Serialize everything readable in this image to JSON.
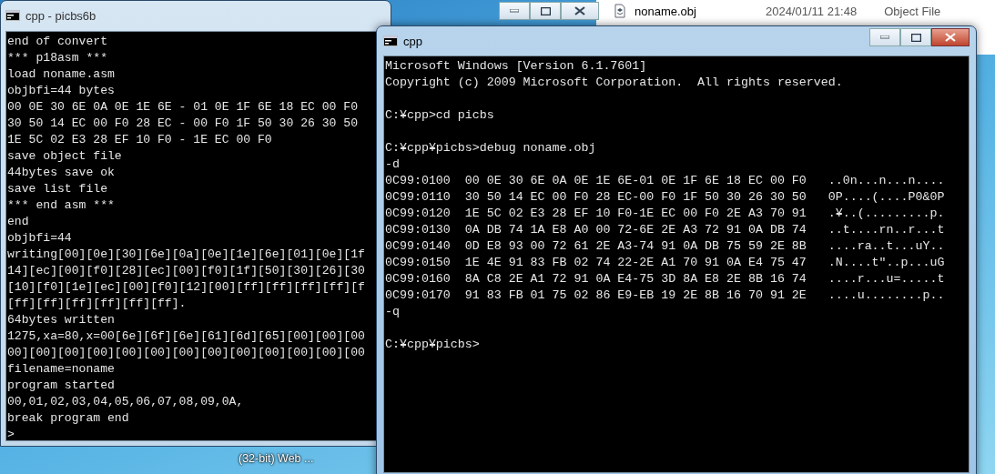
{
  "explorer": {
    "file": {
      "name": "noname.obj",
      "modified": "2024/01/11 21:48",
      "type": "Object File"
    }
  },
  "desktop_icons": [
    {
      "label": "(32-bit) Web ..."
    }
  ],
  "windows": [
    {
      "title": "cpp - picbs6b",
      "active": false,
      "blocks": [
        [
          "end of convert",
          "*** p18asm ***",
          "load noname.asm",
          "objbfi=44 bytes",
          "00 0E 30 6E 0A 0E 1E 6E - 01 0E 1F 6E 18 EC 00 F0",
          "30 50 14 EC 00 F0 28 EC - 00 F0 1F 50 30 26 30 50",
          "1E 5C 02 E3 28 EF 10 F0 - 1E EC 00 F0",
          "save object file",
          "44bytes save ok",
          "save list file",
          "*** end asm ***",
          "end",
          "objbfi=44",
          "writing[00][0e][30][6e][0a][0e][1e][6e][01][0e][1f",
          "14][ec][00][f0][28][ec][00][f0][1f][50][30][26][30",
          "[10][f0][1e][ec][00][f0][12][00][ff][ff][ff][ff][f",
          "[ff][ff][ff][ff][ff][ff].",
          "64bytes written",
          "1275,xa=80,x=00[6e][6f][6e][61][6d][65][00][00][00",
          "00][00][00][00][00][00][00][00][00][00][00][00][00",
          "filename=noname",
          "program started",
          "00,01,02,03,04,05,06,07,08,09,0A,",
          "break program end",
          ">"
        ]
      ]
    },
    {
      "title": "cpp",
      "active": true,
      "blocks": [
        [
          "Microsoft Windows [Version 6.1.7601]",
          "Copyright (c) 2009 Microsoft Corporation.  All rights reserved."
        ],
        [
          "C:¥cpp>cd picbs"
        ],
        [
          "C:¥cpp¥picbs>debug noname.obj",
          "-d",
          "0C99:0100  00 0E 30 6E 0A 0E 1E 6E-01 0E 1F 6E 18 EC 00 F0   ..0n...n...n....",
          "0C99:0110  30 50 14 EC 00 F0 28 EC-00 F0 1F 50 30 26 30 50   0P....(....P0&0P",
          "0C99:0120  1E 5C 02 E3 28 EF 10 F0-1E EC 00 F0 2E A3 70 91   .¥..(.........p.",
          "0C99:0130  0A DB 74 1A E8 A0 00 72-6E 2E A3 72 91 0A DB 74   ..t....rn..r...t",
          "0C99:0140  0D E8 93 00 72 61 2E A3-74 91 0A DB 75 59 2E 8B   ....ra..t...uY..",
          "0C99:0150  1E 4E 91 83 FB 02 74 22-2E A1 70 91 0A E4 75 47   .N....t\"..p...uG",
          "0C99:0160  8A C8 2E A1 72 91 0A E4-75 3D 8A E8 2E 8B 16 74   ....r...u=.....t",
          "0C99:0170  91 83 FB 01 75 02 86 E9-EB 19 2E 8B 16 70 91 2E   ....u........p..",
          "-q"
        ],
        [
          "C:¥cpp¥picbs>"
        ]
      ]
    }
  ]
}
